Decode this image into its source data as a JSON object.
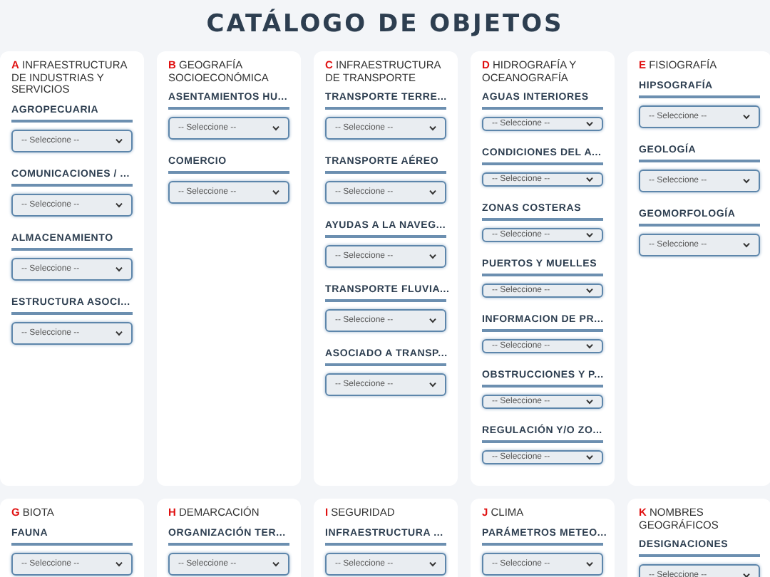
{
  "title": "CATÁLOGO DE OBJETOS",
  "categories": [
    {
      "letter": "A",
      "name": "INFRAESTRUCTURA DE INDUSTRIAS Y SERVICIOS",
      "fields": [
        {
          "label": "AGROPECUARIA",
          "value": "-- Seleccione --"
        },
        {
          "label": "COMUNICACIONES / ...",
          "value": "-- Seleccione --"
        },
        {
          "label": "ALMACENAMIENTO",
          "value": "-- Seleccione --"
        },
        {
          "label": "ESTRUCTURA ASOCI...",
          "value": "-- Seleccione --"
        }
      ]
    },
    {
      "letter": "B",
      "name": "GEOGRAFÍA SOCIOECONÓMICA",
      "fields": [
        {
          "label": "ASENTAMIENTOS HU...",
          "value": "-- Seleccione --"
        },
        {
          "label": "COMERCIO",
          "value": "-- Seleccione --"
        }
      ]
    },
    {
      "letter": "C",
      "name": "INFRAESTRUCTURA DE TRANSPORTE",
      "fields": [
        {
          "label": "TRANSPORTE TERRE...",
          "value": "-- Seleccione --"
        },
        {
          "label": "TRANSPORTE AÉREO",
          "value": "-- Seleccione --"
        },
        {
          "label": "AYUDAS A LA NAVEG...",
          "value": "-- Seleccione --"
        },
        {
          "label": "TRANSPORTE FLUVIA...",
          "value": "-- Seleccione --"
        },
        {
          "label": "ASOCIADO A TRANSP...",
          "value": "-- Seleccione --"
        }
      ]
    },
    {
      "letter": "D",
      "name": "HIDROGRAFÍA Y OCEANOGRAFÍA",
      "fields": [
        {
          "label": "AGUAS INTERIORES",
          "value": "-- Seleccione --"
        },
        {
          "label": "CONDICIONES DEL A...",
          "value": "-- Seleccione --"
        },
        {
          "label": "ZONAS COSTERAS",
          "value": "-- Seleccione --"
        },
        {
          "label": "PUERTOS Y MUELLES",
          "value": "-- Seleccione --"
        },
        {
          "label": "INFORMACION DE PR...",
          "value": "-- Seleccione --"
        },
        {
          "label": "OBSTRUCCIONES Y P...",
          "value": "-- Seleccione --"
        },
        {
          "label": "REGULACIÓN Y/O ZO...",
          "value": "-- Seleccione --"
        }
      ]
    },
    {
      "letter": "E",
      "name": "FISIOGRAFÍA",
      "fields": [
        {
          "label": "HIPSOGRAFÍA",
          "value": "-- Seleccione --"
        },
        {
          "label": "GEOLOGÍA",
          "value": "-- Seleccione --"
        },
        {
          "label": "GEOMORFOLOGÍA",
          "value": "-- Seleccione --"
        }
      ]
    },
    {
      "letter": "G",
      "name": "BIOTA",
      "fields": [
        {
          "label": "FAUNA",
          "value": "-- Seleccione --"
        }
      ]
    },
    {
      "letter": "H",
      "name": "DEMARCACIÓN",
      "fields": [
        {
          "label": "ORGANIZACIÓN TER...",
          "value": "-- Seleccione --"
        }
      ]
    },
    {
      "letter": "I",
      "name": "SEGURIDAD",
      "fields": [
        {
          "label": "INFRAESTRUCTURA ...",
          "value": "-- Seleccione --"
        }
      ]
    },
    {
      "letter": "J",
      "name": "CLIMA",
      "fields": [
        {
          "label": "PARÁMETROS METEO...",
          "value": "-- Seleccione --"
        }
      ]
    },
    {
      "letter": "K",
      "name": "NOMBRES GEOGRÁFICOS",
      "fields": [
        {
          "label": "DESIGNACIONES",
          "value": "-- Seleccione --"
        }
      ]
    }
  ]
}
